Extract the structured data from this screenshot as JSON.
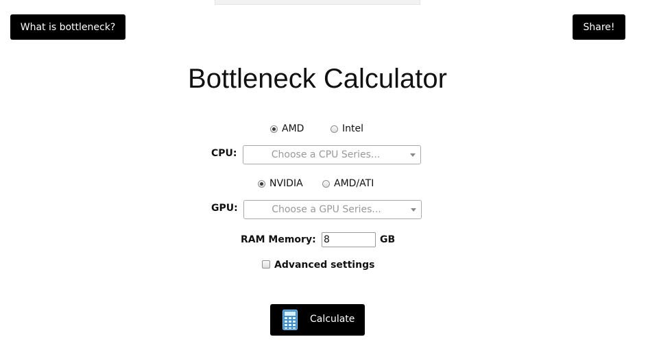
{
  "header": {
    "what_is_label": "What is bottleneck?",
    "share_label": "Share!"
  },
  "title": "Bottleneck Calculator",
  "cpu": {
    "brands": [
      {
        "label": "AMD",
        "checked": true
      },
      {
        "label": "Intel",
        "checked": false
      }
    ],
    "label": "CPU:",
    "placeholder": "Choose a CPU Series..."
  },
  "gpu": {
    "brands": [
      {
        "label": "NVIDIA",
        "checked": true
      },
      {
        "label": "AMD/ATI",
        "checked": false
      }
    ],
    "label": "GPU:",
    "placeholder": "Choose a GPU Series..."
  },
  "ram": {
    "label": "RAM Memory:",
    "value": "8",
    "unit": "GB"
  },
  "advanced": {
    "label": "Advanced settings",
    "checked": false
  },
  "calculate": {
    "label": "Calculate",
    "icon": "calculator-icon"
  },
  "colors": {
    "button_bg": "#000000",
    "button_text": "#ffffff",
    "placeholder_text": "#999999"
  }
}
